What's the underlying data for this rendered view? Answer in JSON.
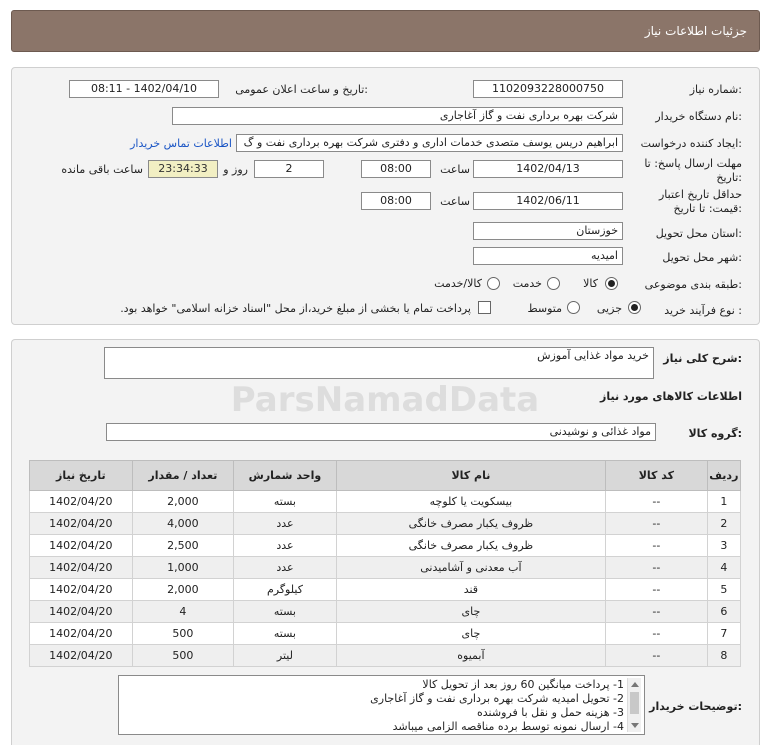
{
  "header": {
    "title": "جزئیات اطلاعات نیاز"
  },
  "form": {
    "need_number": {
      "label": "شماره نیاز:",
      "value": "1102093228000750"
    },
    "announce_datetime": {
      "label": "تاریخ و ساعت اعلان عمومی:",
      "value": "1402/04/10 - 08:11"
    },
    "buyer_org": {
      "label": "نام دستگاه خریدار:",
      "value": "شرکت بهره برداری نفت و گاز آغاجاری"
    },
    "requester": {
      "label": "ایجاد کننده درخواست:",
      "value": "ابراهیم دریس یوسف متصدی خدمات اداری و دفتری شرکت بهره برداری نفت و گ",
      "contact_link": "اطلاعات تماس خریدار"
    },
    "reply_deadline": {
      "label_line1": "مهلت ارسال پاسخ: تا",
      "label_line2": "تاریخ:",
      "date": "1402/04/13",
      "time_label": "ساعت",
      "time": "08:00",
      "days": "2",
      "days_label": "روز و",
      "remaining": "23:34:33",
      "remaining_label": "ساعت باقی مانده"
    },
    "price_validity": {
      "label_line1": "حداقل تاریخ اعتبار",
      "label_line2": "قیمت: تا تاریخ:",
      "date": "1402/06/11",
      "time_label": "ساعت",
      "time": "08:00"
    },
    "delivery_province": {
      "label": "استان محل تحویل:",
      "value": "خوزستان"
    },
    "delivery_city": {
      "label": "شهر محل تحویل:",
      "value": "امیدیه"
    },
    "category": {
      "label": "طبقه بندی موضوعی:",
      "options": [
        "کالا",
        "خدمت",
        "کالا/خدمت"
      ],
      "selected": "کالا"
    },
    "purchase_type": {
      "label": "نوع فرآیند خرید :",
      "options": [
        "جزیی",
        "متوسط"
      ],
      "selected": "جزیی",
      "payment_note": "پرداخت تمام یا بخشی از مبلغ خرید،از محل \"اسناد خزانه اسلامی\" خواهد بود."
    }
  },
  "summary": {
    "label": "شرح کلی نیاز:",
    "value": "خرید مواد غذایی آموزش"
  },
  "items_section": {
    "title": "اطلاعات کالاهای مورد نیاز",
    "group_label": "گروه کالا:",
    "group_value": "مواد غذائی و نوشیدنی"
  },
  "table": {
    "headers": [
      "ردیف",
      "کد کالا",
      "نام کالا",
      "واحد شمارش",
      "تعداد / مقدار",
      "تاریخ نیاز"
    ],
    "rows": [
      [
        "1",
        "--",
        "بیسکویت یا کلوچه",
        "بسته",
        "2,000",
        "1402/04/20"
      ],
      [
        "2",
        "--",
        "ظروف یکبار مصرف خانگی",
        "عدد",
        "4,000",
        "1402/04/20"
      ],
      [
        "3",
        "--",
        "ظروف یکبار مصرف خانگی",
        "عدد",
        "2,500",
        "1402/04/20"
      ],
      [
        "4",
        "--",
        "آب معدنی و آشامیدنی",
        "عدد",
        "1,000",
        "1402/04/20"
      ],
      [
        "5",
        "--",
        "قند",
        "کیلوگرم",
        "2,000",
        "1402/04/20"
      ],
      [
        "6",
        "--",
        "چای",
        "بسته",
        "4",
        "1402/04/20"
      ],
      [
        "7",
        "--",
        "چای",
        "بسته",
        "500",
        "1402/04/20"
      ],
      [
        "8",
        "--",
        "آبمیوه",
        "لیتر",
        "500",
        "1402/04/20"
      ]
    ]
  },
  "buyer_notes": {
    "label": "توضیحات خریدار:",
    "lines": [
      "1- پرداخت میانگین 60 روز بعد از تحویل کالا",
      "2- تحویل امیدیه شرکت بهره برداری نفت و گاز آغاجاری",
      "3- هزینه حمل و نقل با فروشنده",
      "4- ارسال نمونه توسط برده مناقصه الزامی میباشد"
    ]
  },
  "watermark": {
    "text": "ParsNamadData"
  }
}
